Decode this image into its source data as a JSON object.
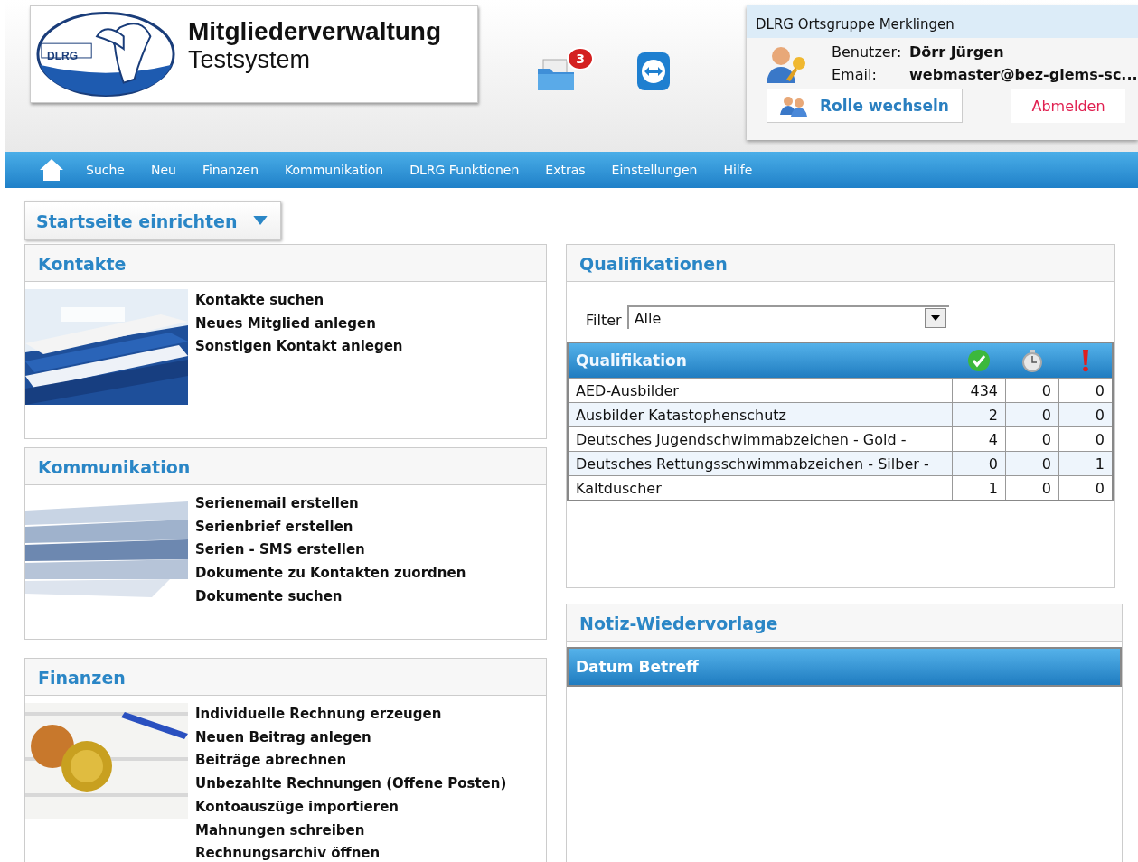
{
  "header": {
    "logo_text": "DLRG",
    "title": "Mitgliederverwaltung",
    "subtitle": "Testsystem",
    "inbox_badge": "3"
  },
  "account": {
    "organization": "DLRG Ortsgruppe Merklingen",
    "user_label": "Benutzer:",
    "user": "Dörr Jürgen",
    "email_label": "Email:",
    "email": "webmaster@bez-glems-sc...",
    "switch_role": "Rolle wechseln",
    "logout": "Abmelden"
  },
  "nav": [
    "Suche",
    "Neu",
    "Finanzen",
    "Kommunikation",
    "DLRG Funktionen",
    "Extras",
    "Einstellungen",
    "Hilfe"
  ],
  "setup_button": "Startseite einrichten",
  "left_sections": [
    {
      "title": "Kontakte",
      "kind": "cards",
      "links": [
        "Kontakte suchen",
        "Neues Mitglied anlegen",
        "Sonstigen Kontakt anlegen"
      ]
    },
    {
      "title": "Kommunikation",
      "kind": "papers",
      "links": [
        "Serienemail erstellen",
        "Serienbrief erstellen",
        "Serien - SMS erstellen",
        "Dokumente zu Kontakten zuordnen",
        "Dokumente suchen"
      ]
    },
    {
      "title": "Finanzen",
      "kind": "coins",
      "links": [
        "Individuelle Rechnung erzeugen",
        "Neuen Beitrag anlegen",
        "Beiträge abrechnen",
        "Unbezahlte Rechnungen (Offene Posten)",
        "Kontoauszüge importieren",
        "Mahnungen schreiben",
        "Rechnungsarchiv öffnen"
      ]
    }
  ],
  "qualifications": {
    "title": "Qualifikationen",
    "filter_label": "Filter",
    "filter_value": "Alle",
    "column": "Qualifikation",
    "rows": [
      {
        "name": "AED-Ausbilder",
        "valid": "434",
        "expiring": "0",
        "expired": "0"
      },
      {
        "name": "Ausbilder Katastophenschutz",
        "valid": "2",
        "expiring": "0",
        "expired": "0"
      },
      {
        "name": "Deutsches Jugendschwimmabzeichen - Gold -",
        "valid": "4",
        "expiring": "0",
        "expired": "0"
      },
      {
        "name": "Deutsches Rettungsschwimmabzeichen - Silber -",
        "valid": "0",
        "expiring": "0",
        "expired": "1"
      },
      {
        "name": "Kaltduscher",
        "valid": "1",
        "expiring": "0",
        "expired": "0"
      }
    ]
  },
  "notes": {
    "title": "Notiz-Wiedervorlage",
    "columns": [
      "Datum",
      "Betreff"
    ]
  }
}
